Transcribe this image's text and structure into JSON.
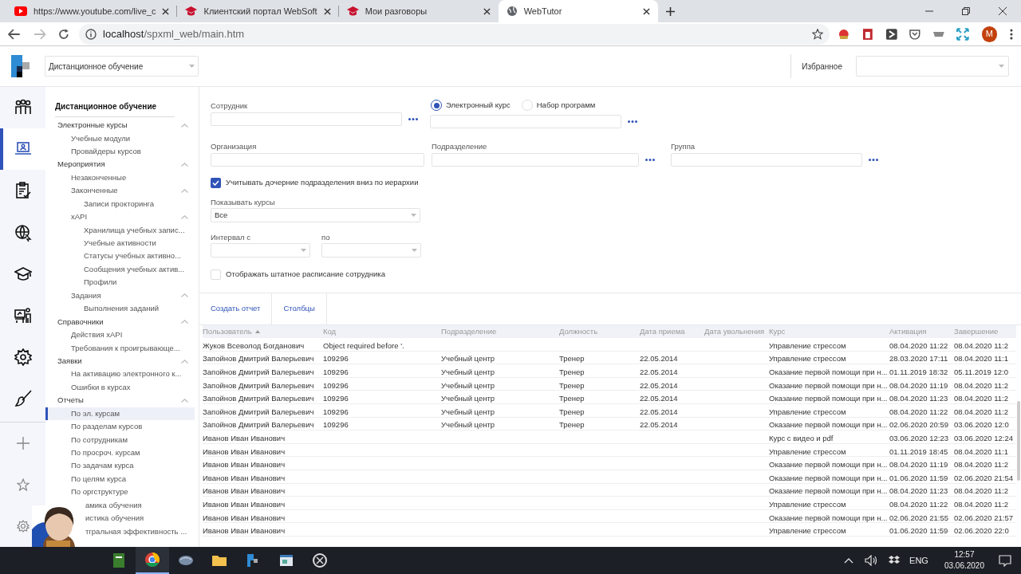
{
  "browser": {
    "tabs": [
      {
        "title": "https://www.youtube.com/live_c",
        "kind": "video",
        "selected": false
      },
      {
        "title": "Клиентский портал WebSoft",
        "kind": "cap",
        "selected": false
      },
      {
        "title": "Мои разговоры",
        "kind": "cap",
        "selected": false
      },
      {
        "title": "WebTutor",
        "kind": "globe",
        "selected": true
      }
    ],
    "address_host": "localhost",
    "address_path": "/spxml_web/main.htm",
    "profile_initial": "M"
  },
  "header": {
    "module_select": "Дистанционное обучение",
    "favorites_label": "Избранное"
  },
  "rail": [
    {
      "selected": false
    },
    {
      "selected": true
    },
    {
      "selected": false
    },
    {
      "selected": false
    },
    {
      "selected": false
    },
    {
      "selected": false
    },
    {
      "selected": false
    },
    {
      "selected": false
    }
  ],
  "sidebar": {
    "title": "Дистанционное обучение",
    "items": [
      {
        "label": "Электронные курсы",
        "expanded": true,
        "selected": false,
        "children": [
          {
            "label": "Учебные модули",
            "selected": false
          },
          {
            "label": "Провайдеры курсов",
            "selected": false
          }
        ]
      },
      {
        "label": "Мероприятия",
        "expanded": true,
        "selected": false,
        "children": [
          {
            "label": "Незаконченные",
            "selected": false
          },
          {
            "label": "Законченные",
            "expanded": true,
            "selected": false,
            "children": [
              {
                "label": "Записи прокторинга",
                "selected": false
              }
            ]
          },
          {
            "label": "xAPI",
            "expanded": true,
            "selected": false,
            "children": [
              {
                "label": "Хранилища учебных запис...",
                "selected": false
              },
              {
                "label": "Учебные активности",
                "selected": false
              },
              {
                "label": "Статусы учебных активно...",
                "selected": false
              },
              {
                "label": "Сообщения учебных актив...",
                "selected": false
              },
              {
                "label": "Профили",
                "selected": false
              }
            ]
          },
          {
            "label": "Задания",
            "expanded": true,
            "selected": false,
            "children": [
              {
                "label": "Выполнения заданий",
                "selected": false
              }
            ]
          }
        ]
      },
      {
        "label": "Справочники",
        "expanded": true,
        "selected": false,
        "children": [
          {
            "label": "Действия xAPI",
            "selected": false
          },
          {
            "label": "Требования к проигрывающе...",
            "selected": false
          }
        ]
      },
      {
        "label": "Заявки",
        "expanded": true,
        "selected": false,
        "children": [
          {
            "label": "На активацию электронного к...",
            "selected": false
          },
          {
            "label": "Ошибки в курсах",
            "selected": false
          }
        ]
      },
      {
        "label": "Отчеты",
        "expanded": true,
        "selected": false,
        "children": [
          {
            "label": "По эл. курсам",
            "selected": true
          },
          {
            "label": "По разделам курсов",
            "selected": false
          },
          {
            "label": "По сотрудникам",
            "selected": false
          },
          {
            "label": "По просроч. курсам",
            "selected": false
          },
          {
            "label": "По задачам курса",
            "selected": false
          },
          {
            "label": "По целям курса",
            "selected": false
          },
          {
            "label": "По оргструктуре",
            "selected": false
          },
          {
            "label": "амика обучения",
            "selected": false,
            "covered": true
          },
          {
            "label": "истика обучения",
            "selected": false,
            "covered": true
          },
          {
            "label": "тгральная эффективность ...",
            "selected": false,
            "covered": true
          }
        ]
      }
    ]
  },
  "form": {
    "employee": {
      "label": "Сотрудник"
    },
    "course_type": [
      {
        "label": "Электронный курс",
        "selected": true
      },
      {
        "label": "Набор программ",
        "selected": false
      }
    ],
    "organization": {
      "label": "Организация"
    },
    "subdivision": {
      "label": "Подразделение"
    },
    "group": {
      "label": "Группа"
    },
    "include_children": {
      "label": "Учитывать дочерние подразделения вниз по иерархии",
      "checked": true
    },
    "show_courses": {
      "label": "Показывать курсы",
      "value": "Все"
    },
    "interval_from": {
      "label": "Интервал с"
    },
    "interval_to": {
      "label": "по"
    },
    "show_staff": {
      "label": "Отображать штатное расписание сотрудника",
      "checked": false
    }
  },
  "actions": [
    "Создать отчет",
    "Столбцы"
  ],
  "table": {
    "columns": [
      {
        "label": "Пользователь",
        "sorted": true
      },
      {
        "label": "Код",
        "sorted": false
      },
      {
        "label": "Подразделение",
        "sorted": false
      },
      {
        "label": "Должность",
        "sorted": false
      },
      {
        "label": "Дата приема",
        "sorted": false
      },
      {
        "label": "Дата увольнения",
        "sorted": false
      },
      {
        "label": "Курс",
        "sorted": false
      },
      {
        "label": "Активация",
        "sorted": false
      },
      {
        "label": "Завершение",
        "sorted": false
      }
    ],
    "rows": [
      [
        "Жуков Всеволод Богданович",
        "Object required before '.",
        null,
        null,
        null,
        null,
        "Управление стрессом",
        "08.04.2020 11:22",
        "08.04.2020 11:2"
      ],
      [
        "Запойнов Дмитрий Валерьевич",
        "109296",
        "Учебный центр",
        "Тренер",
        "22.05.2014",
        null,
        "Управление стрессом",
        "28.03.2020 17:11",
        "08.04.2020 11:1"
      ],
      [
        "Запойнов Дмитрий Валерьевич",
        "109296",
        "Учебный центр",
        "Тренер",
        "22.05.2014",
        null,
        "Оказание первой помощи при н...",
        "01.11.2019 18:32",
        "05.11.2019 12:0"
      ],
      [
        "Запойнов Дмитрий Валерьевич",
        "109296",
        "Учебный центр",
        "Тренер",
        "22.05.2014",
        null,
        "Оказание первой помощи при н...",
        "08.04.2020 11:19",
        "08.04.2020 11:2"
      ],
      [
        "Запойнов Дмитрий Валерьевич",
        "109296",
        "Учебный центр",
        "Тренер",
        "22.05.2014",
        null,
        "Оказание первой помощи при н...",
        "08.04.2020 11:23",
        "08.04.2020 11:2"
      ],
      [
        "Запойнов Дмитрий Валерьевич",
        "109296",
        "Учебный центр",
        "Тренер",
        "22.05.2014",
        null,
        "Управление стрессом",
        "08.04.2020 11:22",
        "08.04.2020 11:2"
      ],
      [
        "Запойнов Дмитрий Валерьевич",
        "109296",
        "Учебный центр",
        "Тренер",
        "22.05.2014",
        null,
        "Оказание первой помощи при н...",
        "02.06.2020 20:59",
        "03.06.2020 12:0"
      ],
      [
        "Иванов Иван Иванович",
        null,
        null,
        null,
        null,
        null,
        "Курс с видео и pdf",
        "03.06.2020 12:23",
        "03.06.2020 12:24"
      ],
      [
        "Иванов Иван Иванович",
        null,
        null,
        null,
        null,
        null,
        "Управление стрессом",
        "01.11.2019 18:45",
        "08.04.2020 11:1"
      ],
      [
        "Иванов Иван Иванович",
        null,
        null,
        null,
        null,
        null,
        "Оказание первой помощи при н...",
        "08.04.2020 11:19",
        "08.04.2020 11:2"
      ],
      [
        "Иванов Иван Иванович",
        null,
        null,
        null,
        null,
        null,
        "Оказание первой помощи при н...",
        "01.06.2020 11:59",
        "02.06.2020 21:54"
      ],
      [
        "Иванов Иван Иванович",
        null,
        null,
        null,
        null,
        null,
        "Оказание первой помощи при н...",
        "08.04.2020 11:23",
        "08.04.2020 11:2"
      ],
      [
        "Иванов Иван Иванович",
        null,
        null,
        null,
        null,
        null,
        "Управление стрессом",
        "08.04.2020 11:22",
        "08.04.2020 11:2"
      ],
      [
        "Иванов Иван Иванович",
        null,
        null,
        null,
        null,
        null,
        "Оказание первой помощи при н...",
        "02.06.2020 21:55",
        "02.06.2020 21:57"
      ],
      [
        "Иванов Иван Иванович",
        null,
        null,
        null,
        null,
        null,
        "Управление стрессом",
        "01.06.2020 11:59",
        "02.06.2020 22:0"
      ]
    ]
  },
  "taskbar": {
    "language": "ENG",
    "time": "12:57",
    "date": "03.06.2020"
  }
}
